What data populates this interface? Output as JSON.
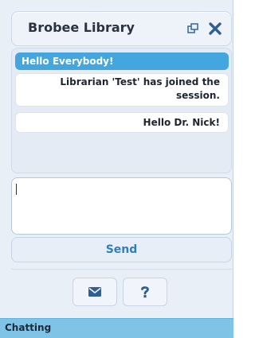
{
  "window": {
    "title": "Brobee Library",
    "icons": {
      "popout": "popout-icon",
      "close": "close-icon"
    }
  },
  "messages": {
    "greeting": "Hello Everybody!",
    "items": [
      "Librarian 'Test' has joined the session.",
      "Hello Dr. Nick!"
    ]
  },
  "composer": {
    "value": "",
    "send_label": "Send"
  },
  "toolbar": {
    "icons": [
      "email-icon",
      "help-icon"
    ]
  },
  "status": {
    "text": "Chatting"
  },
  "colors": {
    "accent": "#43a6df",
    "status_bar": "#7fc4e7",
    "send_text": "#2e7fbf",
    "panel": "#e9eff7"
  }
}
